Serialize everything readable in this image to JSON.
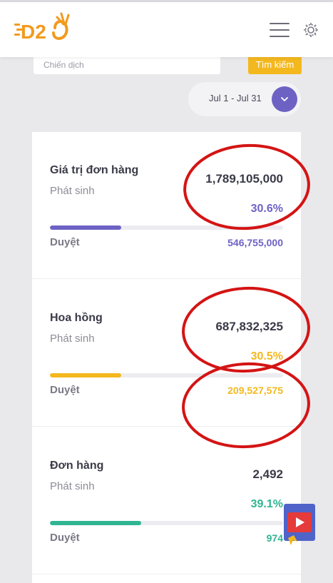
{
  "header": {
    "logo_text": "D2",
    "menu_icon": "hamburger-menu-icon",
    "settings_icon": "gear-icon"
  },
  "search": {
    "placeholder": "Chiến dịch",
    "button_label": "Tìm kiếm"
  },
  "date_filter": {
    "label": "Jul 1 - Jul 31",
    "icon": "chevron-down-icon"
  },
  "cards": [
    {
      "title": "Giá trị đơn hàng",
      "subtitle": "Phát sinh",
      "value": "1,789,105,000",
      "percent": "30.6%",
      "progress_percent": 30.6,
      "approved_label": "Duyệt",
      "approved_value": "546,755,000",
      "color": "#6d62c4"
    },
    {
      "title": "Hoa hồng",
      "subtitle": "Phát sinh",
      "value": "687,832,325",
      "percent": "30.5%",
      "progress_percent": 30.5,
      "approved_label": "Duyệt",
      "approved_value": "209,527,575",
      "color": "#f4b81f"
    },
    {
      "title": "Đơn hàng",
      "subtitle": "Phát sinh",
      "value": "2,492",
      "percent": "39.1%",
      "progress_percent": 39.1,
      "approved_label": "Duyệt",
      "approved_value": "974",
      "color": "#2fb592"
    }
  ],
  "colors": {
    "annotation_red": "#d41414",
    "page_background": "#e9e9ec",
    "video_widget_red": "#e53b3b",
    "video_widget_blue": "#4f63c9"
  },
  "video_widget": {
    "icon": "play-video-icon"
  }
}
